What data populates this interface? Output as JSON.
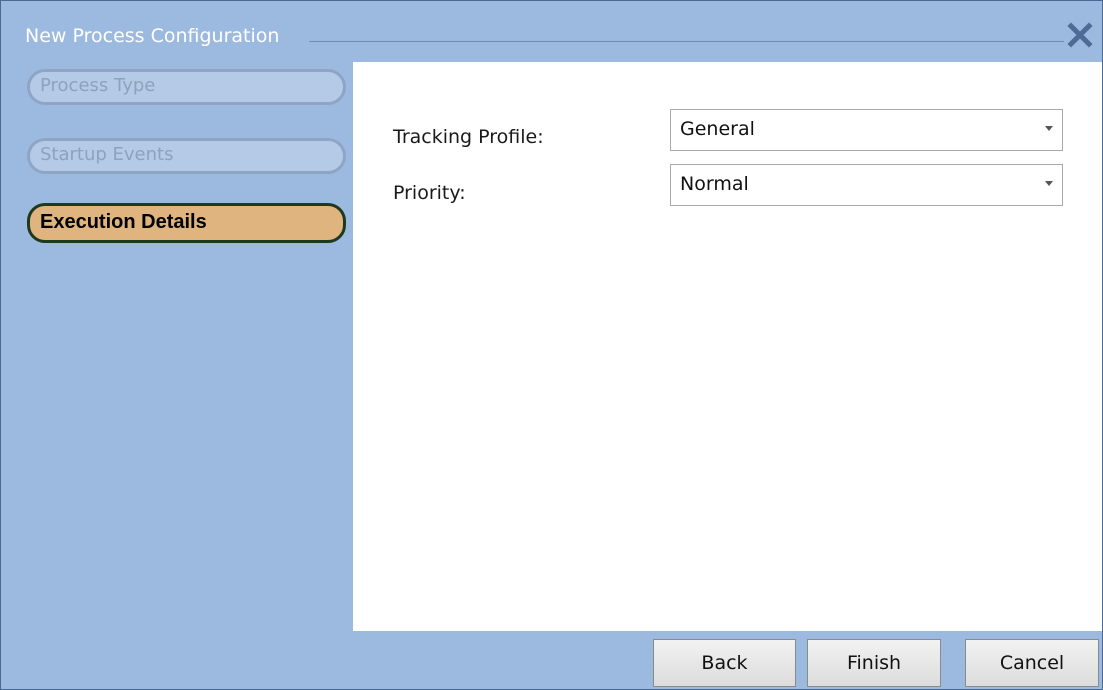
{
  "window": {
    "title": "New Process Configuration"
  },
  "steps": [
    {
      "label": "Process Type",
      "state": "inactive"
    },
    {
      "label": "Startup Events",
      "state": "inactive"
    },
    {
      "label": "Execution Details",
      "state": "active"
    }
  ],
  "form": {
    "tracking_profile": {
      "label": "Tracking Profile:",
      "value": "General"
    },
    "priority": {
      "label": "Priority:",
      "value": "Normal"
    }
  },
  "buttons": {
    "back": "Back",
    "finish": "Finish",
    "cancel": "Cancel"
  },
  "icons": {
    "close": "close-icon",
    "dropdown": "chevron-down-icon"
  },
  "colors": {
    "frame": "#9cb9e0",
    "active_step": "#dfb47f",
    "inactive_step": "#b5cae7"
  }
}
